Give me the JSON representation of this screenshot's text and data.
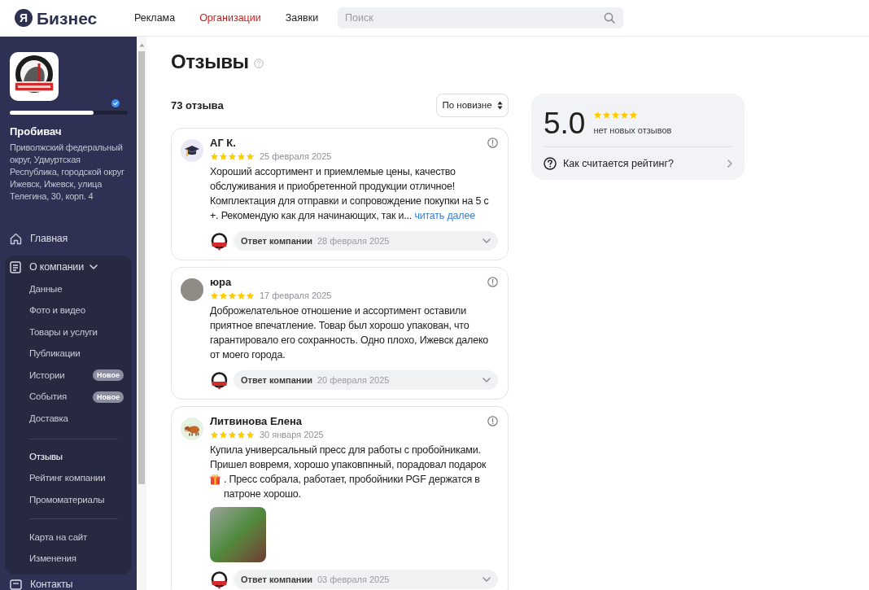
{
  "header": {
    "logo": {
      "mark": "Я",
      "text": "Бизнес"
    },
    "nav": [
      {
        "label": "Реклама",
        "selected": false
      },
      {
        "label": "Организации",
        "selected": true
      },
      {
        "label": "Заявки",
        "selected": false
      }
    ],
    "search": {
      "placeholder": "Поиск"
    }
  },
  "sidebar": {
    "company": {
      "name": "Пробивач",
      "address": "Приволжский федеральный округ, Удмуртская Республика, городской округ Ижевск, Ижевск, улица Телегина, 30, корп. 4",
      "progress": {
        "level": 0.71
      }
    },
    "items": [
      {
        "kind": "link",
        "label": "Главная",
        "selected": false
      },
      {
        "kind": "group",
        "label": "О компании",
        "selected": false,
        "expanded": true,
        "sections": [
          {
            "items": [
              {
                "label": "Данные",
                "selected": false
              },
              {
                "label": "Фото и видео",
                "selected": false
              },
              {
                "label": "Товары и услуги",
                "selected": false
              },
              {
                "label": "Публикации",
                "selected": false
              },
              {
                "label": "Истории",
                "selected": false,
                "badge": "Новое"
              },
              {
                "label": "События",
                "selected": false,
                "badge": "Новое"
              },
              {
                "label": "Доставка",
                "selected": false
              }
            ]
          },
          {
            "items": [
              {
                "label": "Отзывы",
                "selected": true
              },
              {
                "label": "Рейтинг компании",
                "selected": false
              },
              {
                "label": "Промоматериалы",
                "selected": false
              }
            ]
          },
          {
            "items": [
              {
                "label": "Карта на сайт",
                "selected": false
              },
              {
                "label": "Изменения",
                "selected": false
              }
            ]
          }
        ]
      },
      {
        "kind": "link",
        "label": "Контакты",
        "selected": false
      }
    ]
  },
  "main": {
    "title": "Отзывы",
    "count": "73 отзыва",
    "sort": {
      "label": "По новизне"
    },
    "reviews": [
      {
        "author": "АГ К.",
        "avatar": {
          "kind": "icon"
        },
        "stars": 5,
        "date": "25 февраля 2025",
        "body": [
          {
            "kind": "text",
            "text": "Хороший ассортимент и приемлемые цены, качество обслуживания и приобретенной продукции отличное! Комплектация для отправки и сопровождение покупки на 5 с +. Рекомендую как для начинающих, так и..."
          }
        ],
        "read_more": "читать далее",
        "photo_attached": false,
        "reply": {
          "label": "Ответ компании",
          "date": "28 февраля 2025"
        }
      },
      {
        "author": "юра",
        "avatar": {
          "kind": "photo"
        },
        "stars": 5,
        "date": "17 февраля 2025",
        "body": [
          {
            "kind": "text",
            "text": "Доброжелательное отношение и ассортимент оставили приятное впечатление. Товар был хорошо упакован, что гарантировало его сохранность. Одно плохо, Ижевск далеко от моего города."
          }
        ],
        "photo_attached": false,
        "reply": {
          "label": "Ответ компании",
          "date": "20 февраля 2025"
        }
      },
      {
        "author": "Литвинова Елена",
        "avatar": {
          "kind": "icon"
        },
        "stars": 5,
        "date": "30 января 2025",
        "body": [
          {
            "kind": "text",
            "text": "Купила универсальный пресс для работы с пробойниками. Пришел вовремя, хорошо упаковпнный, порадовал подарок"
          },
          {
            "kind": "emoji_text",
            "text": ". Пресс собрала, работает, пробойники PGF держатся в патроне хорошо."
          }
        ],
        "photo_attached": true,
        "reply": {
          "label": "Ответ компании",
          "date": "03 февраля 2025"
        }
      }
    ],
    "rating": {
      "value": "5.0",
      "stars": 5,
      "note": "нет новых отзывов",
      "link": "Как считается рейтинг?"
    }
  }
}
